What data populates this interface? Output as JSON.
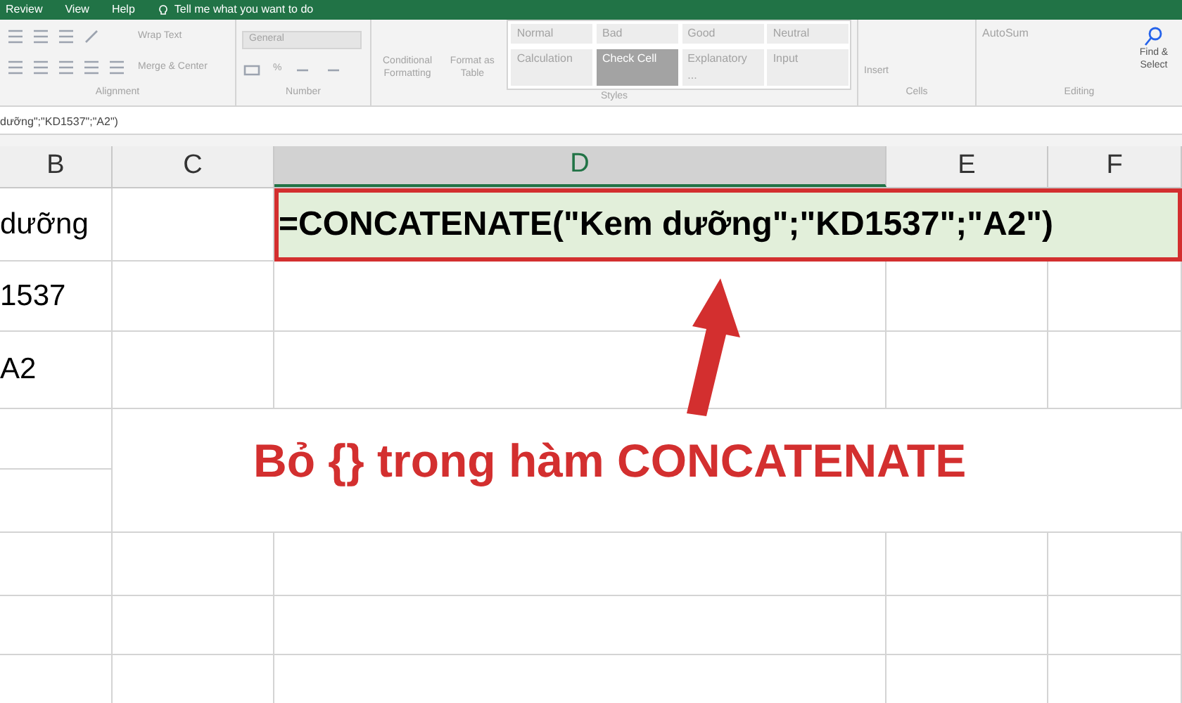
{
  "tabs": [
    {
      "label": "Review"
    },
    {
      "label": "View"
    },
    {
      "label": "Help"
    }
  ],
  "tell_me": "Tell me what you want to do",
  "ribbon": {
    "alignment": {
      "wrap_text": "Wrap Text",
      "merge": "Merge & Center",
      "label": "Alignment"
    },
    "number": {
      "format": "General",
      "percent": "%",
      "label": "Number"
    },
    "styles": {
      "conditional": "Conditional Formatting",
      "format_table": "Format as Table",
      "label": "Styles",
      "cell_styles": [
        {
          "label": "Normal",
          "kind": "plain"
        },
        {
          "label": "Bad",
          "kind": "plain"
        },
        {
          "label": "Good",
          "kind": "plain"
        },
        {
          "label": "Neutral",
          "kind": "plain"
        },
        {
          "label": "Calculation",
          "kind": "plain"
        },
        {
          "label": "Check Cell",
          "kind": "dark"
        },
        {
          "label": "Explanatory ...",
          "kind": "plain"
        },
        {
          "label": "Input",
          "kind": "plain"
        }
      ]
    },
    "cells": {
      "insert": "Insert",
      "label": "Cells"
    },
    "editing": {
      "autosum": "AutoSum",
      "find": "Find & Select",
      "label": "Editing"
    }
  },
  "formula_bar": {
    "value": "dưỡng\";\"KD1537\";\"A2\")"
  },
  "columns": [
    {
      "label": "B",
      "selected": false
    },
    {
      "label": "C",
      "selected": false
    },
    {
      "label": "D",
      "selected": true
    },
    {
      "label": "E",
      "selected": false
    },
    {
      "label": "F",
      "selected": false
    }
  ],
  "rows": [
    {
      "cells": [
        "dưỡng",
        "",
        "=CONCATENATE(\"Kem dưỡng\";\"KD1537\";\"A2\")",
        "",
        ""
      ],
      "selected": true
    },
    {
      "cells": [
        "1537",
        "",
        "",
        "",
        ""
      ],
      "selected": false
    },
    {
      "cells": [
        "A2",
        "",
        "",
        "",
        ""
      ],
      "selected": false
    },
    {
      "cells": [
        "",
        "",
        "",
        "",
        ""
      ],
      "selected": false
    },
    {
      "cells": [
        "",
        "",
        "",
        "",
        ""
      ],
      "selected": false
    },
    {
      "cells": [
        "",
        "",
        "",
        "",
        ""
      ],
      "selected": false
    },
    {
      "cells": [
        "",
        "",
        "",
        "",
        ""
      ],
      "selected": false
    },
    {
      "cells": [
        "",
        "",
        "",
        "",
        ""
      ],
      "selected": false
    }
  ],
  "caption": "Bỏ {} trong hàm CONCATENATE"
}
